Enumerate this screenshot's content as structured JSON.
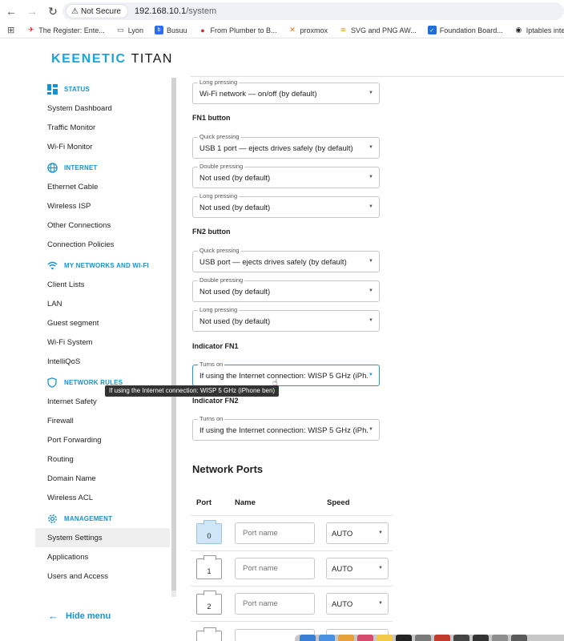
{
  "browser": {
    "security_label": "Not Secure",
    "url_host": "192.168.10.1",
    "url_path": "/system",
    "bookmarks": [
      {
        "label": "The Register: Ente...",
        "icon": "register-icon"
      },
      {
        "label": "Lyon",
        "icon": "folder-icon"
      },
      {
        "label": "Busuu",
        "icon": "busuu-icon"
      },
      {
        "label": "From Plumber to B...",
        "icon": "plumber-icon"
      },
      {
        "label": "proxmox",
        "icon": "proxmox-icon"
      },
      {
        "label": "SVG and PNG AW...",
        "icon": "svg-icon"
      },
      {
        "label": "Foundation Board...",
        "icon": "foundation-icon"
      },
      {
        "label": "Iptables interactiv...",
        "icon": "iptables-icon"
      }
    ]
  },
  "brand": {
    "bold": "KEENETIC",
    "model": "TITAN"
  },
  "sidebar": {
    "status": {
      "title": "STATUS",
      "items": [
        "System Dashboard",
        "Traffic Monitor",
        "Wi-Fi Monitor"
      ]
    },
    "internet": {
      "title": "INTERNET",
      "items": [
        "Ethernet Cable",
        "Wireless ISP",
        "Other Connections",
        "Connection Policies"
      ]
    },
    "networks": {
      "title": "MY NETWORKS AND WI-FI",
      "items": [
        "Client Lists",
        "LAN",
        "Guest segment",
        "Wi-Fi System",
        "IntelliQoS"
      ]
    },
    "rules": {
      "title": "NETWORK RULES",
      "items": [
        "Internet Safety",
        "Firewall",
        "Port Forwarding",
        "Routing",
        "Domain Name",
        "Wireless ACL"
      ]
    },
    "management": {
      "title": "MANAGEMENT",
      "items": [
        "System Settings",
        "Applications",
        "Users and Access"
      ]
    },
    "hide_menu": "Hide menu"
  },
  "form": {
    "top_long": {
      "legend": "Long pressing",
      "value": "Wi-Fi network — on/off (by default)"
    },
    "fn1": {
      "title": "FN1 button",
      "quick": {
        "legend": "Quick pressing",
        "value": "USB 1 port — ejects drives safely (by default)"
      },
      "double": {
        "legend": "Double pressing",
        "value": "Not used (by default)"
      },
      "long": {
        "legend": "Long pressing",
        "value": "Not used (by default)"
      }
    },
    "fn2": {
      "title": "FN2 button",
      "quick": {
        "legend": "Quick pressing",
        "value": "USB port — ejects drives safely (by default)"
      },
      "double": {
        "legend": "Double pressing",
        "value": "Not used (by default)"
      },
      "long": {
        "legend": "Long pressing",
        "value": "Not used (by default)"
      }
    },
    "ind1": {
      "title": "Indicator FN1",
      "legend": "Turns on",
      "value": "If using the Internet connection: WISP 5 GHz (iPh..."
    },
    "ind2": {
      "title": "Indicator FN2",
      "legend": "Turns on",
      "value": "If using the Internet connection: WISP 5 GHz (iPh..."
    },
    "tooltip": "If using the Internet connection: WISP 5 GHz (iPhone ben)"
  },
  "ports": {
    "title": "Network Ports",
    "headers": {
      "port": "Port",
      "name": "Name",
      "speed": "Speed"
    },
    "placeholder": "Port name",
    "rows": [
      {
        "port": "0",
        "speed": "AUTO"
      },
      {
        "port": "1",
        "speed": "AUTO"
      },
      {
        "port": "2",
        "speed": "AUTO"
      }
    ]
  }
}
